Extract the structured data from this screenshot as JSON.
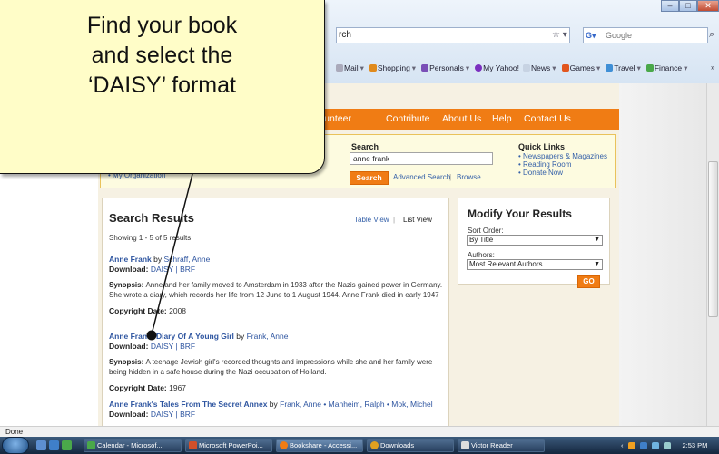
{
  "callout": {
    "lines": [
      "Find your book",
      "and select the",
      "‘DAISY’ format"
    ]
  },
  "browser": {
    "address_tail": "rch",
    "search_engine": "Google",
    "window_buttons": [
      "–",
      "□",
      "✕"
    ],
    "favorites": [
      "Mail",
      "Shopping",
      "Personals",
      "My Yahoo!",
      "News",
      "Games",
      "Travel",
      "Finance"
    ],
    "favorites_more": "»"
  },
  "nav": {
    "items": [
      "olunteer",
      "Contribute",
      "About Us",
      "Help",
      "Contact Us"
    ]
  },
  "search": {
    "my_org": "• My Organization",
    "label": "Search",
    "query": "anne frank",
    "button": "Search",
    "advanced": "Advanced Search",
    "separator": "|",
    "browse": "Browse",
    "quick_links_title": "Quick Links",
    "quick_links": [
      "• Newspapers & Magazines",
      "• Reading Room",
      "• Donate Now"
    ]
  },
  "results": {
    "title": "Search Results",
    "table_view": "Table View",
    "separator": "|",
    "list_view": "List View",
    "showing": "Showing 1 - 5 of 5 results",
    "items": [
      {
        "title": "Anne Frank",
        "by": " by ",
        "authors": "Schraff, Anne",
        "download_label": "Download: ",
        "daisy": "DAISY",
        "sep": " | ",
        "brf": "BRF",
        "synopsis_label": "Synopsis: ",
        "synopsis": "Anne and her family moved to Amsterdam in 1933 after the Nazis gained power in Germany. She wrote a diary, which records her life from 12 June to 1 August 1944. Anne Frank died in early 1947",
        "copyright_label": "Copyright Date: ",
        "copyright": "2008"
      },
      {
        "title": "Anne Frank: Diary Of A Young Girl",
        "by": " by ",
        "authors": "Frank, Anne",
        "download_label": "Download: ",
        "daisy": "DAISY",
        "sep": " | ",
        "brf": "BRF",
        "synopsis_label": "Synopsis: ",
        "synopsis": "A teenage Jewish girl's recorded thoughts and impressions while she and her family were being hidden in a safe house during the Nazi occupation of Holland.",
        "copyright_label": "Copyright Date: ",
        "copyright": "1967"
      },
      {
        "title": "Anne Frank's Tales From The Secret Annex",
        "by": " by ",
        "authors": "Frank, Anne • Manheim, Ralph • Mok, Michel",
        "download_label": "Download: ",
        "daisy": "DAISY",
        "sep": " | ",
        "brf": "BRF"
      }
    ]
  },
  "modify": {
    "title": "Modify Your Results",
    "sort_label": "Sort Order:",
    "sort_value": "By Title",
    "authors_label": "Authors:",
    "authors_value": "Most Relevant Authors",
    "go": "GO"
  },
  "status": "Done",
  "taskbar": {
    "tasks": [
      "Calendar - Microsof...",
      "Microsoft PowerPoi...",
      "Bookshare - Accessi...",
      "Downloads",
      "Victor Reader"
    ],
    "clock": "2:53 PM"
  },
  "colors": {
    "accent_orange": "#f07c14",
    "link_blue": "#2e55a0",
    "callout_fill": "#fffdc8"
  }
}
